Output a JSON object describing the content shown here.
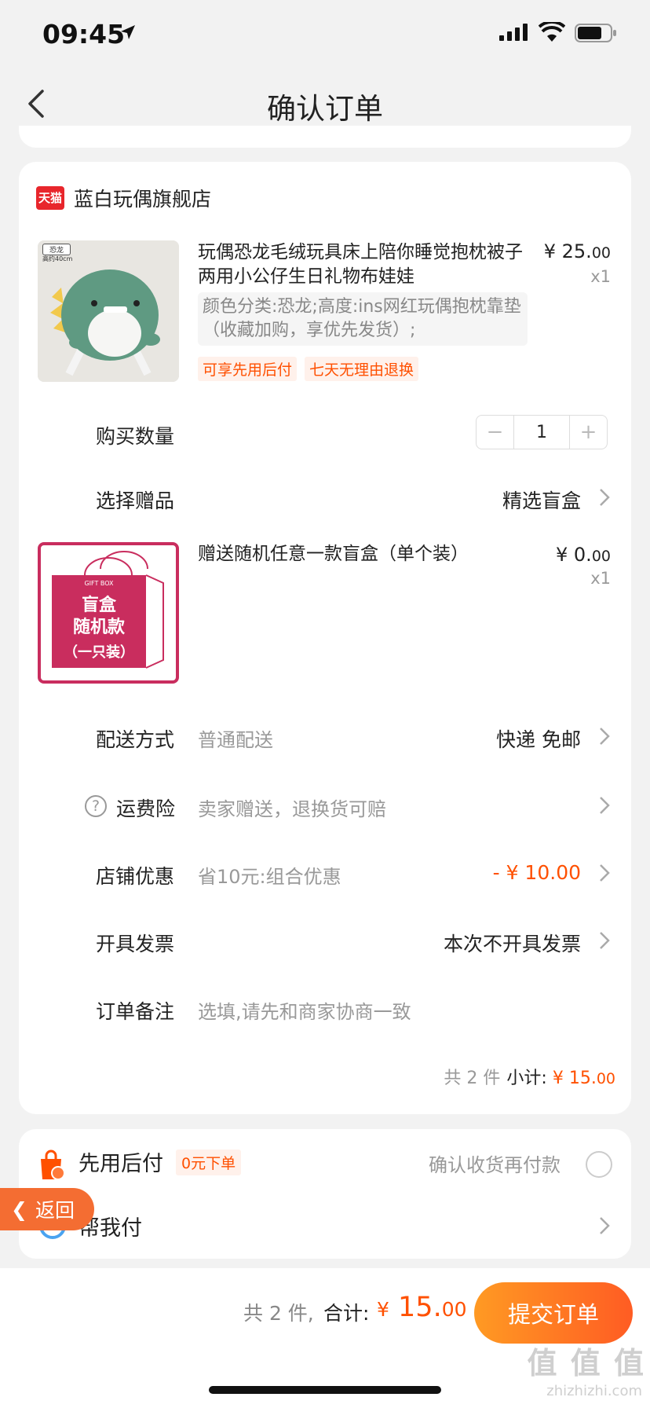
{
  "status_bar": {
    "time": "09:45"
  },
  "nav": {
    "title": "确认订单"
  },
  "shop": {
    "badge": "天猫",
    "name": "蓝白玩偶旗舰店",
    "product": {
      "img_tag_1": "恐龙",
      "img_tag_2": "高约40cm",
      "title": "玩偶恐龙毛绒玩具床上陪你睡觉抱枕被子两用小公仔生日礼物布娃娃",
      "spec": "颜色分类:恐龙;高度:ins网红玩偶抱枕靠垫（收藏加购，享优先发货）;",
      "price_int": "¥ 25.",
      "price_dec": "00",
      "qty": "x1",
      "tags": [
        "可享先用后付",
        "七天无理由退换"
      ]
    },
    "quantity": {
      "label": "购买数量",
      "value": "1",
      "minus": "−",
      "plus": "+"
    },
    "gift": {
      "label": "选择赠品",
      "value": "精选盲盒"
    },
    "gift_item": {
      "box_small": "GIFT BOX",
      "box_line1": "盲盒",
      "box_line2": "随机款",
      "box_line3": "（一只装）",
      "title": "赠送随机任意一款盲盒（单个装）",
      "price_int": "¥ 0.",
      "price_dec": "00",
      "qty": "x1"
    },
    "delivery": {
      "label": "配送方式",
      "sub": "普通配送",
      "value": "快递 免邮"
    },
    "insurance": {
      "icon": "?",
      "label": "运费险",
      "sub": "卖家赠送，退换货可赔"
    },
    "discount": {
      "label": "店铺优惠",
      "sub": "省10元:组合优惠",
      "value": "- ¥ 10.00"
    },
    "invoice": {
      "label": "开具发票",
      "value": "本次不开具发票"
    },
    "note": {
      "label": "订单备注",
      "placeholder": "选填,请先和商家协商一致"
    },
    "subtotal": {
      "count": "共 2 件",
      "label": "小计:",
      "amount_int": "¥ 15.",
      "amount_dec": "00"
    }
  },
  "payment": {
    "later_label": "先用后付",
    "later_badge": "0元下单",
    "later_note": "确认收货再付款",
    "help_pay_label": "帮我付"
  },
  "floating_back": {
    "label": "返回"
  },
  "bottom_bar": {
    "count": "共 2 件,",
    "total_label": "合计:",
    "total_currency": "¥",
    "total_int": " 15.",
    "total_dec": "00",
    "submit": "提交订单"
  },
  "watermark": {
    "main": "值 值 值",
    "sub": "zhizhizhi.com"
  },
  "colors": {
    "accent": "#ff5000",
    "tmall_red": "#e8262c",
    "gift_pink": "#c92d5e",
    "submit_gradient_start": "#ff9a23",
    "submit_gradient_end": "#ff5c23"
  }
}
